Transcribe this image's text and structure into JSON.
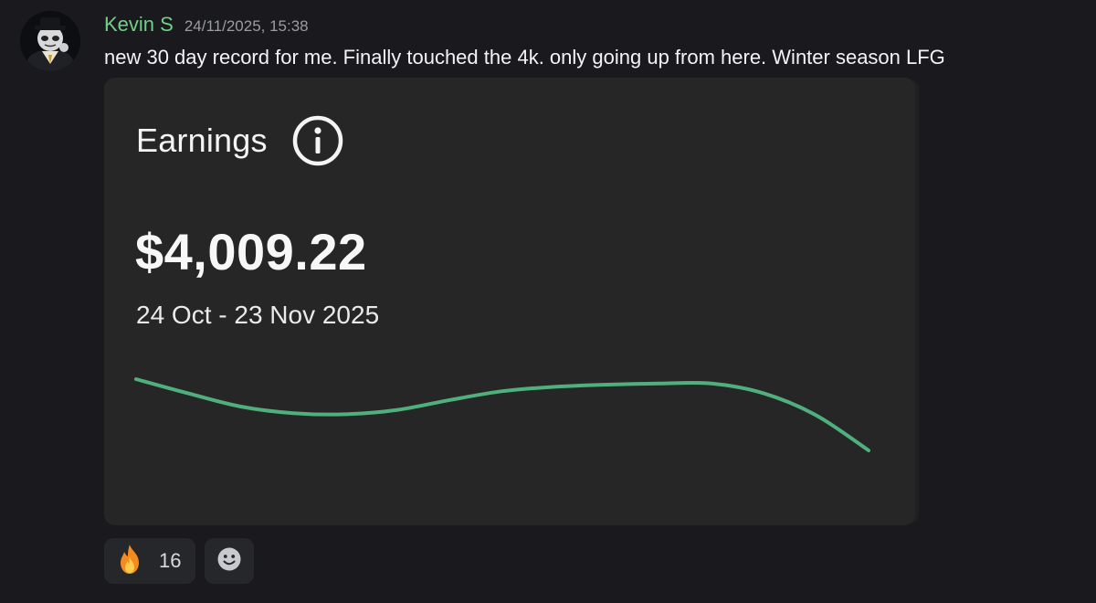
{
  "message": {
    "author": "Kevin S",
    "timestamp": "24/11/2025, 15:38",
    "content": "new 30 day record for me. Finally touched the 4k. only going up from here. Winter season LFG",
    "author_color": "#6fd087"
  },
  "embed": {
    "title": "Earnings",
    "amount": "$4,009.22",
    "period": "24 Oct - 23 Nov 2025",
    "info_icon": "info-icon",
    "line_color": "#4fb07e"
  },
  "chart_data": {
    "type": "line",
    "title": "",
    "xlabel": "",
    "ylabel": "",
    "grid": false,
    "legend": "none",
    "series": [
      {
        "values": [
          0.75,
          0.62,
          0.5,
          0.44,
          0.43,
          0.47,
          0.56,
          0.64,
          0.68,
          0.7,
          0.71,
          0.71,
          0.62,
          0.42,
          0.1
        ]
      }
    ],
    "ylim": [
      0,
      1
    ]
  },
  "reactions": [
    {
      "icon": "fire-emoji",
      "count": "16"
    },
    {
      "icon": "add-reaction-icon"
    }
  ]
}
